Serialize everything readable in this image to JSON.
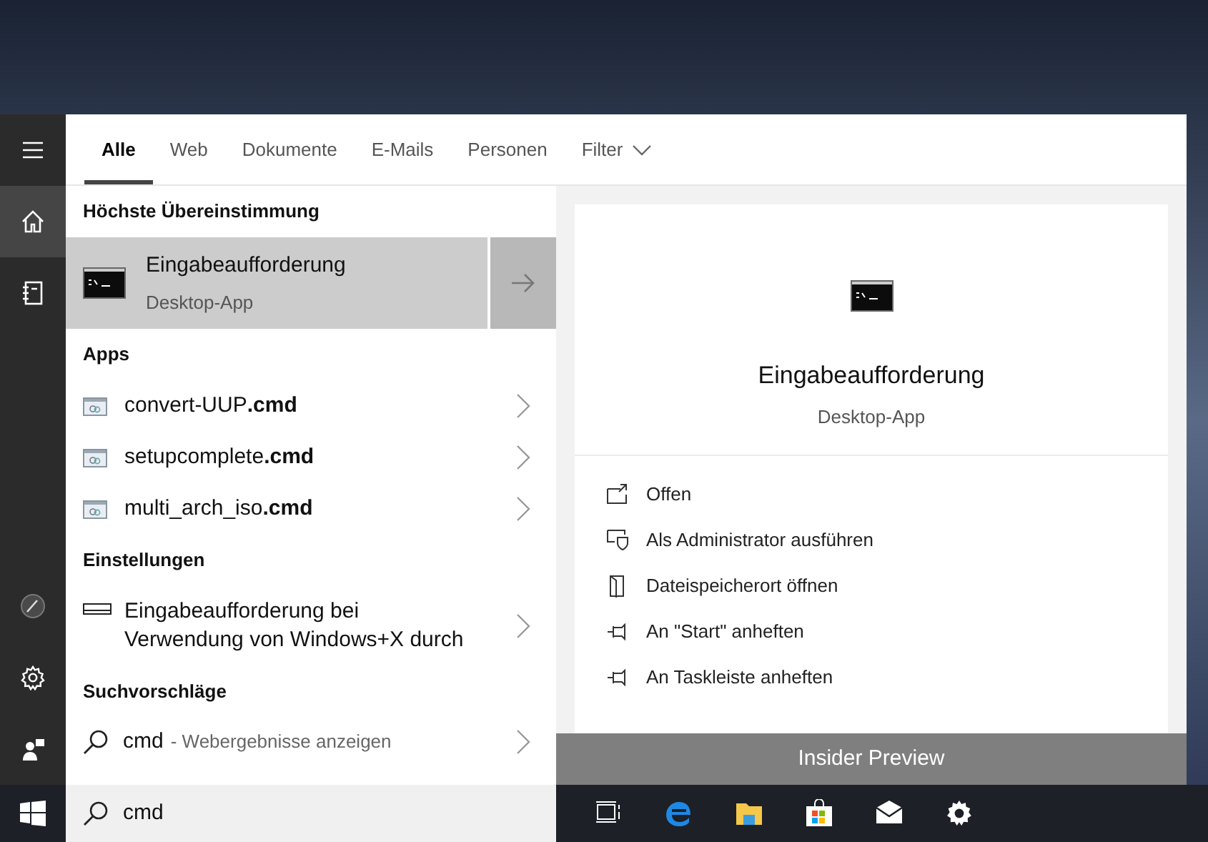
{
  "rail": {
    "top": [
      {
        "kind": "menu",
        "selected": false
      },
      {
        "kind": "home",
        "selected": true
      },
      {
        "kind": "notebook",
        "selected": false
      }
    ],
    "bottom": [
      {
        "kind": "pen",
        "selected": false
      },
      {
        "kind": "settings",
        "selected": false
      },
      {
        "kind": "feedback",
        "selected": false
      }
    ]
  },
  "tabs": [
    {
      "label": "Alle",
      "selected": true
    },
    {
      "label": "Web",
      "selected": false
    },
    {
      "label": "Dokumente",
      "selected": false
    },
    {
      "label": "E-Mails",
      "selected": false
    },
    {
      "label": "Personen",
      "selected": false
    },
    {
      "label": "Filter",
      "selected": false,
      "kind": "dropdown"
    }
  ],
  "best_match": {
    "heading": "Höchste Übereinstimmung",
    "title": "Eingabeaufforderung",
    "subtitle": "Desktop-App",
    "selected": true
  },
  "apps": {
    "heading": "Apps",
    "items": [
      {
        "name": "convert-UUP**.cmd**"
      },
      {
        "name": "setupcomplete**.cmd**"
      },
      {
        "name": "multi_arch_iso**.cmd**"
      }
    ]
  },
  "settings": {
    "heading": "Einstellungen",
    "items": [
      {
        "name": "Eingabeaufforderung bei Verwendung von Windows+X durch"
      }
    ]
  },
  "suggestions": {
    "heading": "Suchvorschläge",
    "items": [
      {
        "query": "cmd",
        "hint": "- Webergebnisse anzeigen"
      }
    ]
  },
  "preview": {
    "title": "Eingabeaufforderung",
    "subtitle": "Desktop-App",
    "actions": [
      {
        "label": "Offen",
        "kind": "open"
      },
      {
        "label": "Als Administrator ausführen",
        "kind": "admin"
      },
      {
        "label": "Dateispeicherort öffnen",
        "kind": "location"
      },
      {
        "label": "An \"Start\" anheften",
        "kind": "pin"
      },
      {
        "label": "An Taskleiste anheften",
        "kind": "pin"
      }
    ]
  },
  "banner": "Insider Preview",
  "search_box": {
    "value": "cmd"
  },
  "taskbar": [
    {
      "kind": "taskview"
    },
    {
      "kind": "browser"
    },
    {
      "kind": "folder"
    },
    {
      "kind": "store"
    },
    {
      "kind": "mail"
    },
    {
      "kind": "settings"
    }
  ]
}
